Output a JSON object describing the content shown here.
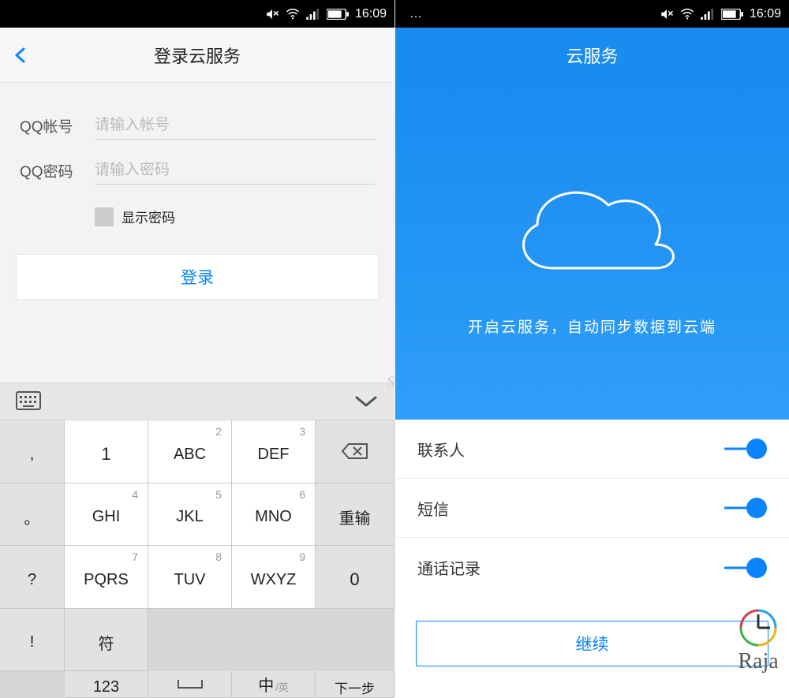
{
  "statusbar": {
    "time": "16:09",
    "show_dots": true
  },
  "login": {
    "nav_title": "登录云服务",
    "account_label": "QQ帐号",
    "account_placeholder": "请输入帐号",
    "password_label": "QQ密码",
    "password_placeholder": "请输入密码",
    "show_password_label": "显示密码",
    "login_button": "登录"
  },
  "keypad": {
    "side_left": [
      ",",
      "。",
      "?",
      "!"
    ],
    "numbers": [
      "1",
      "2",
      "3",
      "4",
      "5",
      "6",
      "7",
      "8",
      "9",
      "7",
      "8",
      "9"
    ],
    "keys": [
      {
        "num": "1",
        "label": "1"
      },
      {
        "num": "2",
        "label": "ABC"
      },
      {
        "num": "3",
        "label": "DEF"
      },
      {
        "num": "4",
        "label": "GHI"
      },
      {
        "num": "5",
        "label": "JKL"
      },
      {
        "num": "6",
        "label": "MNO"
      },
      {
        "num": "7",
        "label": "PQRS"
      },
      {
        "num": "8",
        "label": "TUV"
      },
      {
        "num": "9",
        "label": "WXYZ"
      }
    ],
    "bottom": {
      "sym": "符",
      "num": "123",
      "space": "␣",
      "mode_main": "中",
      "mode_sub": "/英",
      "zero": "0",
      "retype": "重输",
      "next": "下一步"
    }
  },
  "cloud": {
    "nav_title": "云服务",
    "hero_text": "开启云服务，自动同步数据到云端",
    "toggles": [
      {
        "label": "联系人",
        "on": true
      },
      {
        "label": "短信",
        "on": true
      },
      {
        "label": "通话记录",
        "on": true
      }
    ],
    "continue_button": "继续"
  },
  "watermark": "Raja"
}
